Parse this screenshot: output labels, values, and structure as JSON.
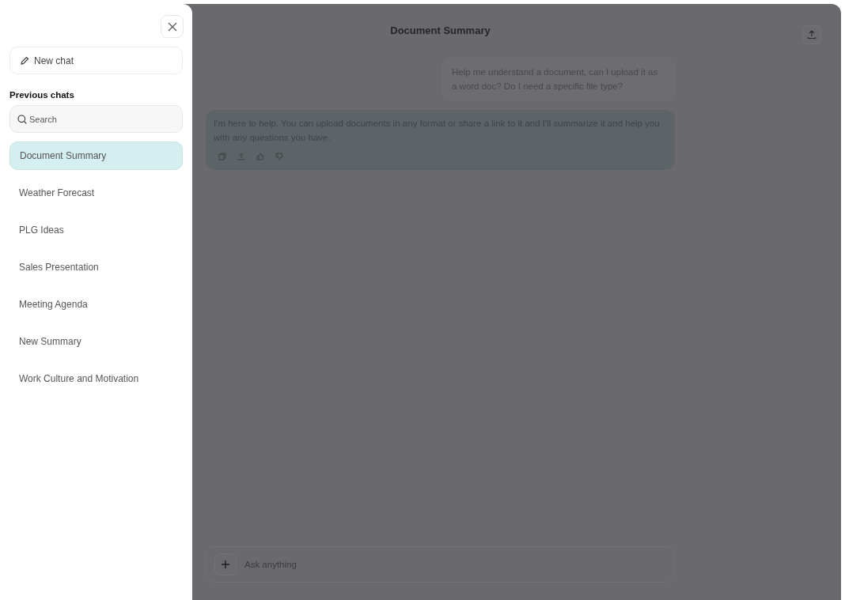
{
  "sidebar": {
    "new_chat": "New chat",
    "section_title": "Previous chats",
    "search": {
      "placeholder": "Search"
    },
    "chats": [
      {
        "label": "Document Summary",
        "selected": true
      },
      {
        "label": "Weather Forecast",
        "selected": false
      },
      {
        "label": "PLG Ideas",
        "selected": false
      },
      {
        "label": "Sales Presentation",
        "selected": false
      },
      {
        "label": "Meeting Agenda",
        "selected": false
      },
      {
        "label": "New Summary",
        "selected": false
      },
      {
        "label": "Work Culture and Motivation",
        "selected": false
      }
    ]
  },
  "chat": {
    "title": "Document Summary",
    "user_message": "Help me understand a document, can I upload it as a word doc? Do I need a specific file type?",
    "reply": "I'm here to help. You can upload documents in any format or share a link to it and I'll summarize it and help you with any questions you have.",
    "composer": {
      "placeholder": "Ask anything"
    }
  }
}
